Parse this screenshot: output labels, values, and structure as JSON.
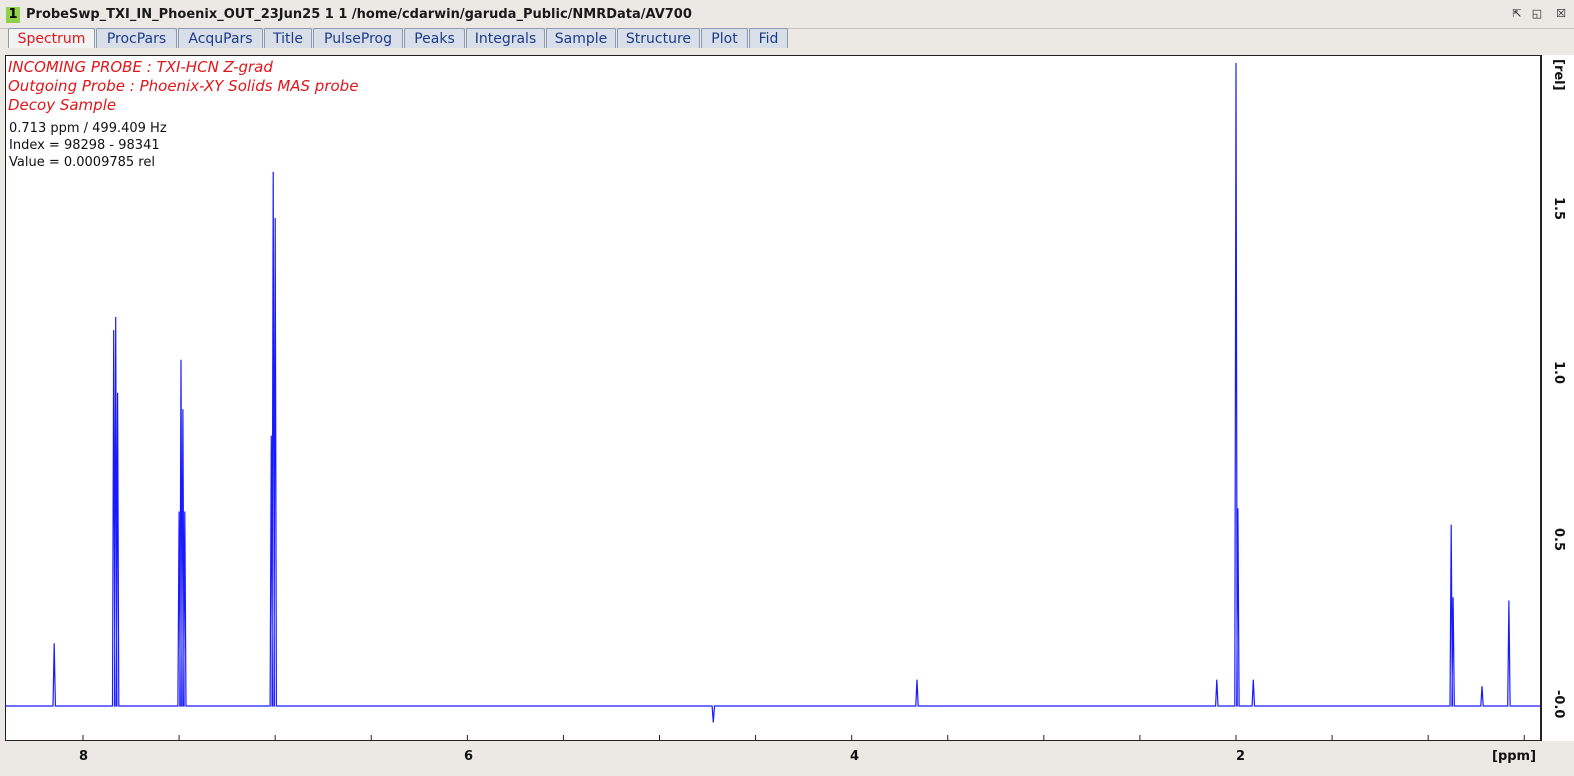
{
  "window": {
    "number": "1",
    "title": "ProbeSwp_TXI_IN_Phoenix_OUT_23Jun25  1  1  /home/cdarwin/garuda_Public/NMRData/AV700",
    "controls": [
      "restore-icon",
      "maximize-icon",
      "close-icon"
    ]
  },
  "tabs": [
    {
      "label": "Spectrum",
      "active": true
    },
    {
      "label": "ProcPars",
      "active": false
    },
    {
      "label": "AcquPars",
      "active": false
    },
    {
      "label": "Title",
      "active": false
    },
    {
      "label": "PulseProg",
      "active": false
    },
    {
      "label": "Peaks",
      "active": false
    },
    {
      "label": "Integrals",
      "active": false
    },
    {
      "label": "Sample",
      "active": false
    },
    {
      "label": "Structure",
      "active": false
    },
    {
      "label": "Plot",
      "active": false
    },
    {
      "label": "Fid",
      "active": false
    }
  ],
  "annotation": {
    "line1": "INCOMING PROBE : TXI-HCN Z-grad",
    "line2": "Outgoing Probe : Phoenix-XY Solids MAS probe",
    "line3": "Decoy Sample"
  },
  "cursor": {
    "position": "0.713 ppm / 499.409 Hz",
    "index": "Index = 98298 - 98341",
    "value": "Value = 0.0009785  rel"
  },
  "colors": {
    "spectrum": "#1a1aff",
    "annotation": "#e0161b",
    "active_tab": "#e0161b"
  },
  "chart_data": {
    "type": "line",
    "xlabel": "[ppm]",
    "ylabel": "[rel]",
    "x_reversed": true,
    "xlim": [
      8.5,
      0.0
    ],
    "ylim": [
      -0.1,
      1.95
    ],
    "x_ticks": [
      8,
      6,
      4,
      2
    ],
    "y_ticks": [
      "-0.0",
      "0.5",
      "1.0",
      "1.5"
    ],
    "cursor_line_ppm": 0.25,
    "peaks": [
      {
        "ppm": 8.15,
        "height": 0.19
      },
      {
        "ppm": 7.84,
        "height": 1.14
      },
      {
        "ppm": 7.83,
        "height": 1.18
      },
      {
        "ppm": 7.82,
        "height": 0.95
      },
      {
        "ppm": 7.5,
        "height": 0.59
      },
      {
        "ppm": 7.49,
        "height": 1.05
      },
      {
        "ppm": 7.48,
        "height": 0.9
      },
      {
        "ppm": 7.47,
        "height": 0.59
      },
      {
        "ppm": 7.02,
        "height": 0.82
      },
      {
        "ppm": 7.01,
        "height": 1.62
      },
      {
        "ppm": 7.0,
        "height": 1.48
      },
      {
        "ppm": 4.72,
        "height": -0.05
      },
      {
        "ppm": 3.66,
        "height": 0.08
      },
      {
        "ppm": 2.1,
        "height": 0.08
      },
      {
        "ppm": 2.0,
        "height": 1.95
      },
      {
        "ppm": 1.99,
        "height": 0.6
      },
      {
        "ppm": 1.91,
        "height": 0.08
      },
      {
        "ppm": 0.88,
        "height": 0.55
      },
      {
        "ppm": 0.87,
        "height": 0.33
      },
      {
        "ppm": 0.72,
        "height": 0.06
      },
      {
        "ppm": 0.58,
        "height": 0.32
      }
    ]
  },
  "axes": {
    "x_unit": "[ppm]",
    "y_unit": "[rel]"
  }
}
